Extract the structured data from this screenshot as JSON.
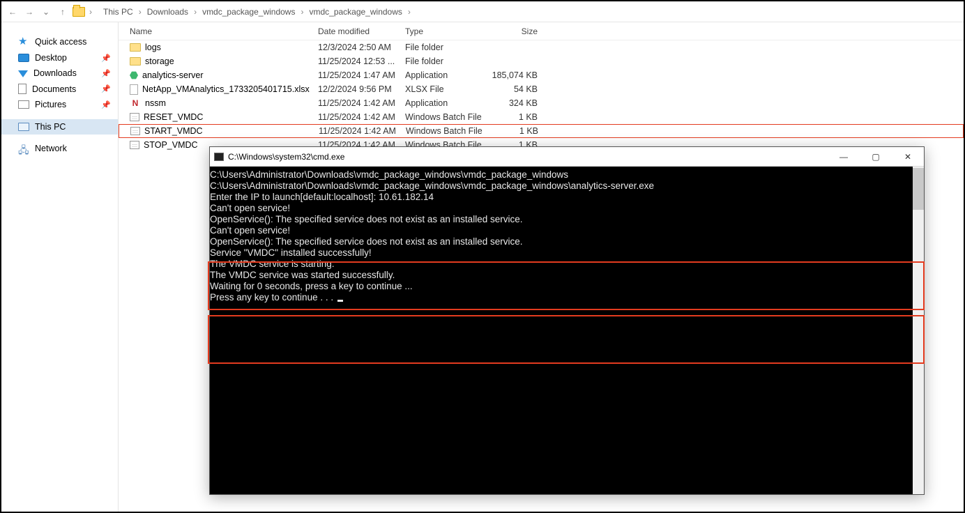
{
  "nav": {
    "back": "←",
    "forward": "→",
    "dropdown": "⌄",
    "up": "↑",
    "crumbs": [
      "This PC",
      "Downloads",
      "vmdc_package_windows",
      "vmdc_package_windows"
    ]
  },
  "sidebar": {
    "quick_access": "Quick access",
    "items": [
      {
        "label": "Desktop"
      },
      {
        "label": "Downloads"
      },
      {
        "label": "Documents"
      },
      {
        "label": "Pictures"
      }
    ],
    "this_pc": "This PC",
    "network": "Network"
  },
  "columns": {
    "name": "Name",
    "date": "Date modified",
    "type": "Type",
    "size": "Size"
  },
  "files": [
    {
      "icon": "folder",
      "name": "logs",
      "date": "12/3/2024 2:50 AM",
      "type": "File folder",
      "size": ""
    },
    {
      "icon": "folder",
      "name": "storage",
      "date": "11/25/2024 12:53 ...",
      "type": "File folder",
      "size": ""
    },
    {
      "icon": "hex",
      "name": "analytics-server",
      "date": "11/25/2024 1:47 AM",
      "type": "Application",
      "size": "185,074 KB"
    },
    {
      "icon": "file",
      "name": "NetApp_VMAnalytics_1733205401715.xlsx",
      "date": "12/2/2024 9:56 PM",
      "type": "XLSX File",
      "size": "54 KB"
    },
    {
      "icon": "n",
      "name": "nssm",
      "date": "11/25/2024 1:42 AM",
      "type": "Application",
      "size": "324 KB"
    },
    {
      "icon": "bat",
      "name": "RESET_VMDC",
      "date": "11/25/2024 1:42 AM",
      "type": "Windows Batch File",
      "size": "1 KB"
    },
    {
      "icon": "bat",
      "name": "START_VMDC",
      "date": "11/25/2024 1:42 AM",
      "type": "Windows Batch File",
      "size": "1 KB",
      "highlight": true
    },
    {
      "icon": "bat",
      "name": "STOP_VMDC",
      "date": "11/25/2024 1:42 AM",
      "type": "Windows Batch File",
      "size": "1 KB"
    }
  ],
  "cmd": {
    "title": "C:\\Windows\\system32\\cmd.exe",
    "lines": [
      "C:\\Users\\Administrator\\Downloads\\vmdc_package_windows\\vmdc_package_windows",
      "C:\\Users\\Administrator\\Downloads\\vmdc_package_windows\\vmdc_package_windows\\analytics-server.exe",
      "Enter the IP to launch[default:localhost]: 10.61.182.14",
      "Can't open service!",
      "OpenService(): The specified service does not exist as an installed service.",
      "",
      "Can't open service!",
      "OpenService(): The specified service does not exist as an installed service.",
      "",
      "Service \"VMDC\" installed successfully!",
      "The VMDC service is starting.",
      "The VMDC service was started successfully.",
      "",
      "",
      "Waiting for 0 seconds, press a key to continue ...",
      "Press any key to continue . . . "
    ],
    "min": "—",
    "max": "▢",
    "close": "✕"
  }
}
